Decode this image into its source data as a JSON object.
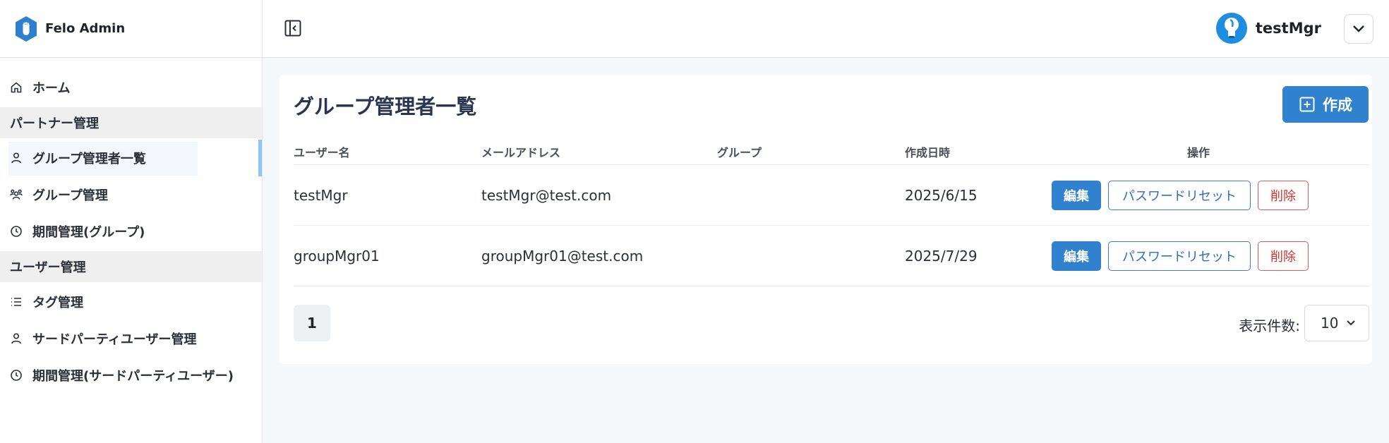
{
  "app": {
    "title": "Felo Admin"
  },
  "sidebar": {
    "items": [
      {
        "type": "item",
        "label": "ホーム",
        "icon": "home-icon"
      },
      {
        "type": "section",
        "label": "パートナー管理"
      },
      {
        "type": "item",
        "label": "グループ管理者一覧",
        "icon": "user-icon",
        "active": true
      },
      {
        "type": "item",
        "label": "グループ管理",
        "icon": "users-icon"
      },
      {
        "type": "item",
        "label": "期間管理(グループ)",
        "icon": "clock-icon"
      },
      {
        "type": "section",
        "label": "ユーザー管理"
      },
      {
        "type": "item",
        "label": "タグ管理",
        "icon": "list-icon"
      },
      {
        "type": "item",
        "label": "サードパーティユーザー管理",
        "icon": "user-icon"
      },
      {
        "type": "item",
        "label": "期間管理(サードパーティユーザー)",
        "icon": "clock-icon"
      }
    ]
  },
  "header": {
    "toggle_icon": "sidebar-collapse-icon",
    "user_name": "testMgr",
    "dropdown_icon": "chevron-down-icon"
  },
  "main": {
    "title": "グループ管理者一覧",
    "create_label": "作成",
    "columns": [
      "ユーザー名",
      "メールアドレス",
      "グループ",
      "作成日時",
      "操作"
    ],
    "rows": [
      {
        "username": "testMgr",
        "email": "testMgr@test.com",
        "group": "",
        "created": "2025/6/15"
      },
      {
        "username": "groupMgr01",
        "email": "groupMgr01@test.com",
        "group": "",
        "created": "2025/7/29"
      }
    ],
    "actions": {
      "edit": "編集",
      "reset": "パスワードリセット",
      "delete": "削除"
    },
    "pagination": {
      "current_page": "1",
      "per_page_label": "表示件数:",
      "per_page_value": "10"
    }
  },
  "colors": {
    "primary": "#3182ce",
    "danger": "#d0342c",
    "active_bar": "#8fc5f2",
    "section_bg": "#efefef",
    "page_bg": "#f5f8fb"
  }
}
